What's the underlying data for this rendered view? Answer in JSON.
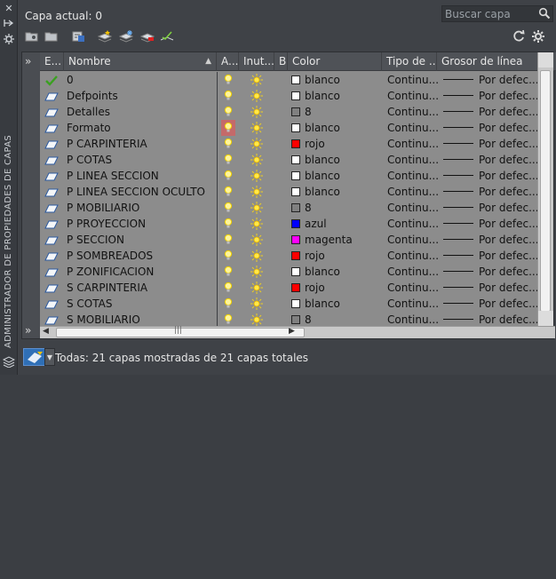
{
  "side_panel": {
    "title": "ADMINISTRADOR DE PROPIEDADES DE CAPAS"
  },
  "header": {
    "current_layer": "Capa actual: 0",
    "search_placeholder": "Buscar capa"
  },
  "columns": {
    "estado": "E...",
    "nombre": "Nombre",
    "activado": "A...",
    "inutilizar": "Inut...",
    "bloqueo": "B",
    "color": "Color",
    "tipo_linea": "Tipo de ...",
    "grosor": "Grosor de línea"
  },
  "layers": [
    {
      "name": "0",
      "color_name": "blanco",
      "color": "#ffffff",
      "linetype": "Continu...",
      "lineweight": "Por defec...",
      "current": true,
      "frozen_hl": false
    },
    {
      "name": "Defpoints",
      "color_name": "blanco",
      "color": "#ffffff",
      "linetype": "Continu...",
      "lineweight": "Por defec...",
      "current": false,
      "frozen_hl": false
    },
    {
      "name": "Detalles",
      "color_name": "8",
      "color": "#808080",
      "linetype": "Continu...",
      "lineweight": "Por defec...",
      "current": false,
      "frozen_hl": false
    },
    {
      "name": "Formato",
      "color_name": "blanco",
      "color": "#ffffff",
      "linetype": "Continu...",
      "lineweight": "Por defec...",
      "current": false,
      "frozen_hl": true
    },
    {
      "name": "P CARPINTERIA",
      "color_name": "rojo",
      "color": "#ff0000",
      "linetype": "Continu...",
      "lineweight": "Por defec...",
      "current": false,
      "frozen_hl": false
    },
    {
      "name": "P COTAS",
      "color_name": "blanco",
      "color": "#ffffff",
      "linetype": "Continu...",
      "lineweight": "Por defec...",
      "current": false,
      "frozen_hl": false
    },
    {
      "name": "P LINEA SECCION",
      "color_name": "blanco",
      "color": "#ffffff",
      "linetype": "Continu...",
      "lineweight": "Por defec...",
      "current": false,
      "frozen_hl": false
    },
    {
      "name": "P LINEA SECCION OCULTO",
      "color_name": "blanco",
      "color": "#ffffff",
      "linetype": "Continu...",
      "lineweight": "Por defec...",
      "current": false,
      "frozen_hl": false
    },
    {
      "name": "P MOBILIARIO",
      "color_name": "8",
      "color": "#808080",
      "linetype": "Continu...",
      "lineweight": "Por defec...",
      "current": false,
      "frozen_hl": false
    },
    {
      "name": "P PROYECCION",
      "color_name": "azul",
      "color": "#0000ff",
      "linetype": "Continu...",
      "lineweight": "Por defec...",
      "current": false,
      "frozen_hl": false
    },
    {
      "name": "P SECCION",
      "color_name": "magenta",
      "color": "#ff00ff",
      "linetype": "Continu...",
      "lineweight": "Por defec...",
      "current": false,
      "frozen_hl": false
    },
    {
      "name": "P SOMBREADOS",
      "color_name": "rojo",
      "color": "#ff0000",
      "linetype": "Continu...",
      "lineweight": "Por defec...",
      "current": false,
      "frozen_hl": false
    },
    {
      "name": "P ZONIFICACION",
      "color_name": "blanco",
      "color": "#ffffff",
      "linetype": "Continu...",
      "lineweight": "Por defec...",
      "current": false,
      "frozen_hl": false
    },
    {
      "name": "S CARPINTERIA",
      "color_name": "rojo",
      "color": "#ff0000",
      "linetype": "Continu...",
      "lineweight": "Por defec...",
      "current": false,
      "frozen_hl": false
    },
    {
      "name": "S COTAS",
      "color_name": "blanco",
      "color": "#ffffff",
      "linetype": "Continu...",
      "lineweight": "Por defec...",
      "current": false,
      "frozen_hl": false
    },
    {
      "name": "S MOBILIARIO",
      "color_name": "8",
      "color": "#808080",
      "linetype": "Continu...",
      "lineweight": "Por defec...",
      "current": false,
      "frozen_hl": false
    }
  ],
  "status": {
    "text": "Todas: 21 capas mostradas de 21 capas totales"
  },
  "icons": {
    "close": "close-icon",
    "autohide": "autohide-icon",
    "properties": "properties-icon",
    "new_group_filter": "new-property-filter-icon",
    "new_group": "new-group-filter-icon",
    "layer_states": "layer-states-icon",
    "new_layer": "new-layer-icon",
    "new_vp_frozen": "new-layer-vp-frozen-icon",
    "delete_layer": "delete-layer-icon",
    "set_current": "set-current-icon",
    "refresh": "refresh-icon",
    "settings": "settings-icon"
  }
}
